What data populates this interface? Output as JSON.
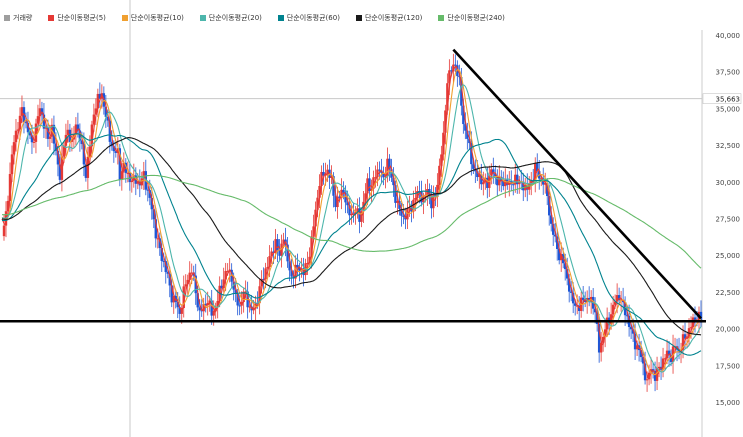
{
  "legend": [
    {
      "label": "거래량",
      "color": "#9e9e9e"
    },
    {
      "label": "단순이동평균(5)",
      "color": "#e53935"
    },
    {
      "label": "단순이동평균(10)",
      "color": "#f0a030"
    },
    {
      "label": "단순이동평균(20)",
      "color": "#4db6ac"
    },
    {
      "label": "단순이동평균(60)",
      "color": "#00838f"
    },
    {
      "label": "단순이동평균(120)",
      "color": "#1a1a1a"
    },
    {
      "label": "단순이동평균(240)",
      "color": "#66bb6a"
    }
  ],
  "current_price_label": "35,663",
  "chart_data": {
    "type": "candlestick",
    "y_axis": {
      "ticks": [
        15000,
        17500,
        20000,
        22500,
        25000,
        27500,
        30000,
        32500,
        35000,
        37500,
        40000
      ],
      "tick_labels": [
        "15,000",
        "17,500",
        "20,000",
        "22,500",
        "25,000",
        "27,500",
        "30,000",
        "32,500",
        "35,000",
        "37,500",
        "40,000"
      ],
      "ylim": [
        12500,
        41000
      ]
    },
    "grid": false,
    "up_color": "#e53935",
    "down_color": "#1e56d6",
    "close_path": [
      [
        0,
        26300
      ],
      [
        4,
        27700
      ],
      [
        8,
        30500
      ],
      [
        12,
        32800
      ],
      [
        16,
        33900
      ],
      [
        20,
        34800
      ],
      [
        26,
        33500
      ],
      [
        30,
        32500
      ],
      [
        34,
        33800
      ],
      [
        38,
        35000
      ],
      [
        42,
        34000
      ],
      [
        46,
        32800
      ],
      [
        50,
        33800
      ],
      [
        54,
        31800
      ],
      [
        58,
        30500
      ],
      [
        62,
        32500
      ],
      [
        66,
        33600
      ],
      [
        70,
        32500
      ],
      [
        74,
        34000
      ],
      [
        78,
        33000
      ],
      [
        84,
        30500
      ],
      [
        88,
        32500
      ],
      [
        92,
        34800
      ],
      [
        96,
        35600
      ],
      [
        100,
        36000
      ],
      [
        104,
        34500
      ],
      [
        108,
        33000
      ],
      [
        112,
        32000
      ],
      [
        116,
        32000
      ],
      [
        118,
        30500
      ],
      [
        122,
        31000
      ],
      [
        126,
        30500
      ],
      [
        130,
        30000
      ],
      [
        134,
        30200
      ],
      [
        138,
        29800
      ],
      [
        142,
        30500
      ],
      [
        146,
        29300
      ],
      [
        150,
        28200
      ],
      [
        154,
        26500
      ],
      [
        158,
        25300
      ],
      [
        162,
        24500
      ],
      [
        166,
        23500
      ],
      [
        170,
        22200
      ],
      [
        174,
        21800
      ],
      [
        178,
        21000
      ],
      [
        182,
        22500
      ],
      [
        186,
        23500
      ],
      [
        190,
        24000
      ],
      [
        194,
        22500
      ],
      [
        198,
        21000
      ],
      [
        202,
        21500
      ],
      [
        206,
        22000
      ],
      [
        210,
        21000
      ],
      [
        214,
        21500
      ],
      [
        218,
        22500
      ],
      [
        222,
        23500
      ],
      [
        226,
        24000
      ],
      [
        230,
        23500
      ],
      [
        234,
        22000
      ],
      [
        238,
        21500
      ],
      [
        242,
        22500
      ],
      [
        246,
        21800
      ],
      [
        250,
        21200
      ],
      [
        254,
        21500
      ],
      [
        258,
        22800
      ],
      [
        262,
        23500
      ],
      [
        266,
        24500
      ],
      [
        270,
        25000
      ],
      [
        274,
        26000
      ],
      [
        278,
        24800
      ],
      [
        282,
        26500
      ],
      [
        286,
        24500
      ],
      [
        290,
        23500
      ],
      [
        294,
        24000
      ],
      [
        298,
        24200
      ],
      [
        302,
        23800
      ],
      [
        306,
        24500
      ],
      [
        310,
        26000
      ],
      [
        314,
        28000
      ],
      [
        318,
        30000
      ],
      [
        322,
        30500
      ],
      [
        326,
        30800
      ],
      [
        330,
        30000
      ],
      [
        334,
        28500
      ],
      [
        338,
        29000
      ],
      [
        342,
        29500
      ],
      [
        346,
        28000
      ],
      [
        350,
        27800
      ],
      [
        354,
        28000
      ],
      [
        358,
        27600
      ],
      [
        362,
        28500
      ],
      [
        366,
        30000
      ],
      [
        370,
        29500
      ],
      [
        374,
        30500
      ],
      [
        378,
        31000
      ],
      [
        382,
        30000
      ],
      [
        386,
        31500
      ],
      [
        390,
        30200
      ],
      [
        394,
        29000
      ],
      [
        398,
        28000
      ],
      [
        402,
        27600
      ],
      [
        406,
        27900
      ],
      [
        410,
        28300
      ],
      [
        414,
        29000
      ],
      [
        418,
        29300
      ],
      [
        422,
        28700
      ],
      [
        426,
        29500
      ],
      [
        430,
        28500
      ],
      [
        434,
        29000
      ],
      [
        438,
        31000
      ],
      [
        442,
        33000
      ],
      [
        446,
        37000
      ],
      [
        450,
        37600
      ],
      [
        454,
        38100
      ],
      [
        458,
        36700
      ],
      [
        462,
        34000
      ],
      [
        466,
        33000
      ],
      [
        470,
        31500
      ],
      [
        474,
        30500
      ],
      [
        478,
        30300
      ],
      [
        482,
        30000
      ],
      [
        486,
        29800
      ],
      [
        490,
        31000
      ],
      [
        494,
        30000
      ],
      [
        498,
        30300
      ],
      [
        502,
        29700
      ],
      [
        506,
        30200
      ],
      [
        510,
        29600
      ],
      [
        514,
        30400
      ],
      [
        518,
        29800
      ],
      [
        522,
        29800
      ],
      [
        526,
        29500
      ],
      [
        530,
        30000
      ],
      [
        534,
        31000
      ],
      [
        538,
        30300
      ],
      [
        542,
        30100
      ],
      [
        546,
        29000
      ],
      [
        550,
        27000
      ],
      [
        554,
        26000
      ],
      [
        558,
        25000
      ],
      [
        562,
        24500
      ],
      [
        566,
        23500
      ],
      [
        570,
        22000
      ],
      [
        574,
        21700
      ],
      [
        578,
        21300
      ],
      [
        582,
        22200
      ],
      [
        586,
        21800
      ],
      [
        590,
        22000
      ],
      [
        594,
        21200
      ],
      [
        598,
        18600
      ],
      [
        602,
        19500
      ],
      [
        606,
        20400
      ],
      [
        610,
        21000
      ],
      [
        614,
        21900
      ],
      [
        618,
        22300
      ],
      [
        622,
        21500
      ],
      [
        626,
        20800
      ],
      [
        630,
        19800
      ],
      [
        634,
        19000
      ],
      [
        638,
        18500
      ],
      [
        642,
        17500
      ],
      [
        646,
        16300
      ],
      [
        650,
        17400
      ],
      [
        654,
        16700
      ],
      [
        658,
        17300
      ],
      [
        662,
        17800
      ],
      [
        666,
        18300
      ],
      [
        670,
        18100
      ],
      [
        674,
        18800
      ],
      [
        678,
        18400
      ],
      [
        682,
        19200
      ],
      [
        686,
        19600
      ],
      [
        690,
        20200
      ],
      [
        694,
        20700
      ],
      [
        698,
        20800
      ],
      [
        700,
        20500
      ]
    ],
    "moving_averages": [
      {
        "period": 5,
        "color": "#e53935"
      },
      {
        "period": 10,
        "color": "#f0a030"
      },
      {
        "period": 20,
        "color": "#4db6ac"
      },
      {
        "period": 60,
        "color": "#00838f"
      },
      {
        "period": 120,
        "color": "#1a1a1a"
      },
      {
        "period": 240,
        "color": "#66bb6a"
      }
    ],
    "trendline_descending": [
      [
        452,
        39000
      ],
      [
        700,
        20700
      ]
    ],
    "support_line": 20500,
    "current_price": 35663
  }
}
